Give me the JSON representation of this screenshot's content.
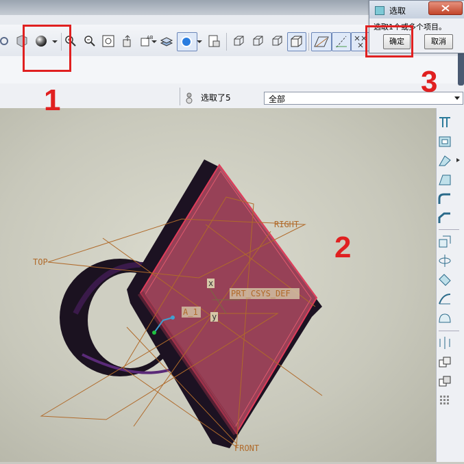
{
  "dialog": {
    "title": "选取",
    "prompt": "选取1个或多个项目。",
    "ok_label": "确定",
    "cancel_label": "取消"
  },
  "statusbar": {
    "selected_text": "选取了5",
    "filter_value": "全部"
  },
  "viewport": {
    "datum_top": "TOP",
    "datum_right": "RIGHT",
    "datum_front": "FRONT",
    "csys_label": "PRT_CSYS_DEF",
    "axis_label": "A_1",
    "x_label": "x",
    "y_label": "y"
  },
  "annotations": {
    "step1": "1",
    "step2": "2",
    "step3": "3"
  },
  "colors": {
    "annotation_red": "#e02020",
    "surface_pink": "#a8485e",
    "datum_orange": "#b06a2a"
  }
}
